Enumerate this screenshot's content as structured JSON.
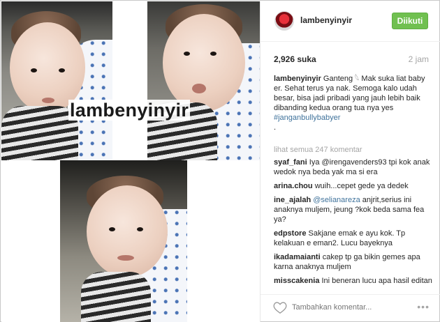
{
  "post": {
    "watermark": "lambenyinyir",
    "username": "lambenyinyir",
    "follow_label": "Diikuti",
    "likes": "2,926 suka",
    "time": "2 jam"
  },
  "caption": {
    "user": "lambenyinyir",
    "text": "Ganteng 𓆩 Mak suka liat baby er. Sehat terus ya nak. Semoga kalo udah besar, bisa jadi pribadi yang jauh lebih baik dibanding kedua orang tua nya yes",
    "hashtag": "#janganbullybabyer",
    "dot": "."
  },
  "view_all": "lihat semua 247 komentar",
  "comments": [
    {
      "user": "syaf_fani",
      "mention": "",
      "text": "Iya @irengavenders93 tpi kok anak wedok nya beda yak ma si era"
    },
    {
      "user": "arina.chou",
      "mention": "",
      "text": "wuih...cepet gede ya dedek"
    },
    {
      "user": "ine_ajalah",
      "mention": "@selianareza",
      "text": "anjrit,serius ini anaknya muljem, jeung ?kok beda sama fea ya?"
    },
    {
      "user": "edpstore",
      "mention": "",
      "text": "Sakjane emak e ayu kok. Tp kelakuan e eman2. Lucu bayeknya"
    },
    {
      "user": "ikadamaianti",
      "mention": "",
      "text": "cakep tp ga bikin gemes apa karna anaknya muljem"
    },
    {
      "user": "misscakenia",
      "mention": "",
      "text": "Ini beneran lucu apa hasil editan makeya?!"
    }
  ],
  "footer": {
    "add_comment_placeholder": "Tambahkan komentar...",
    "more": "•••"
  },
  "icons": {
    "heart": "heart-icon",
    "more": "more-options-icon",
    "avatar": "avatar"
  },
  "colors": {
    "follow_bg": "#70c050",
    "link": "#3f729b",
    "muted": "#a5a5a5"
  }
}
